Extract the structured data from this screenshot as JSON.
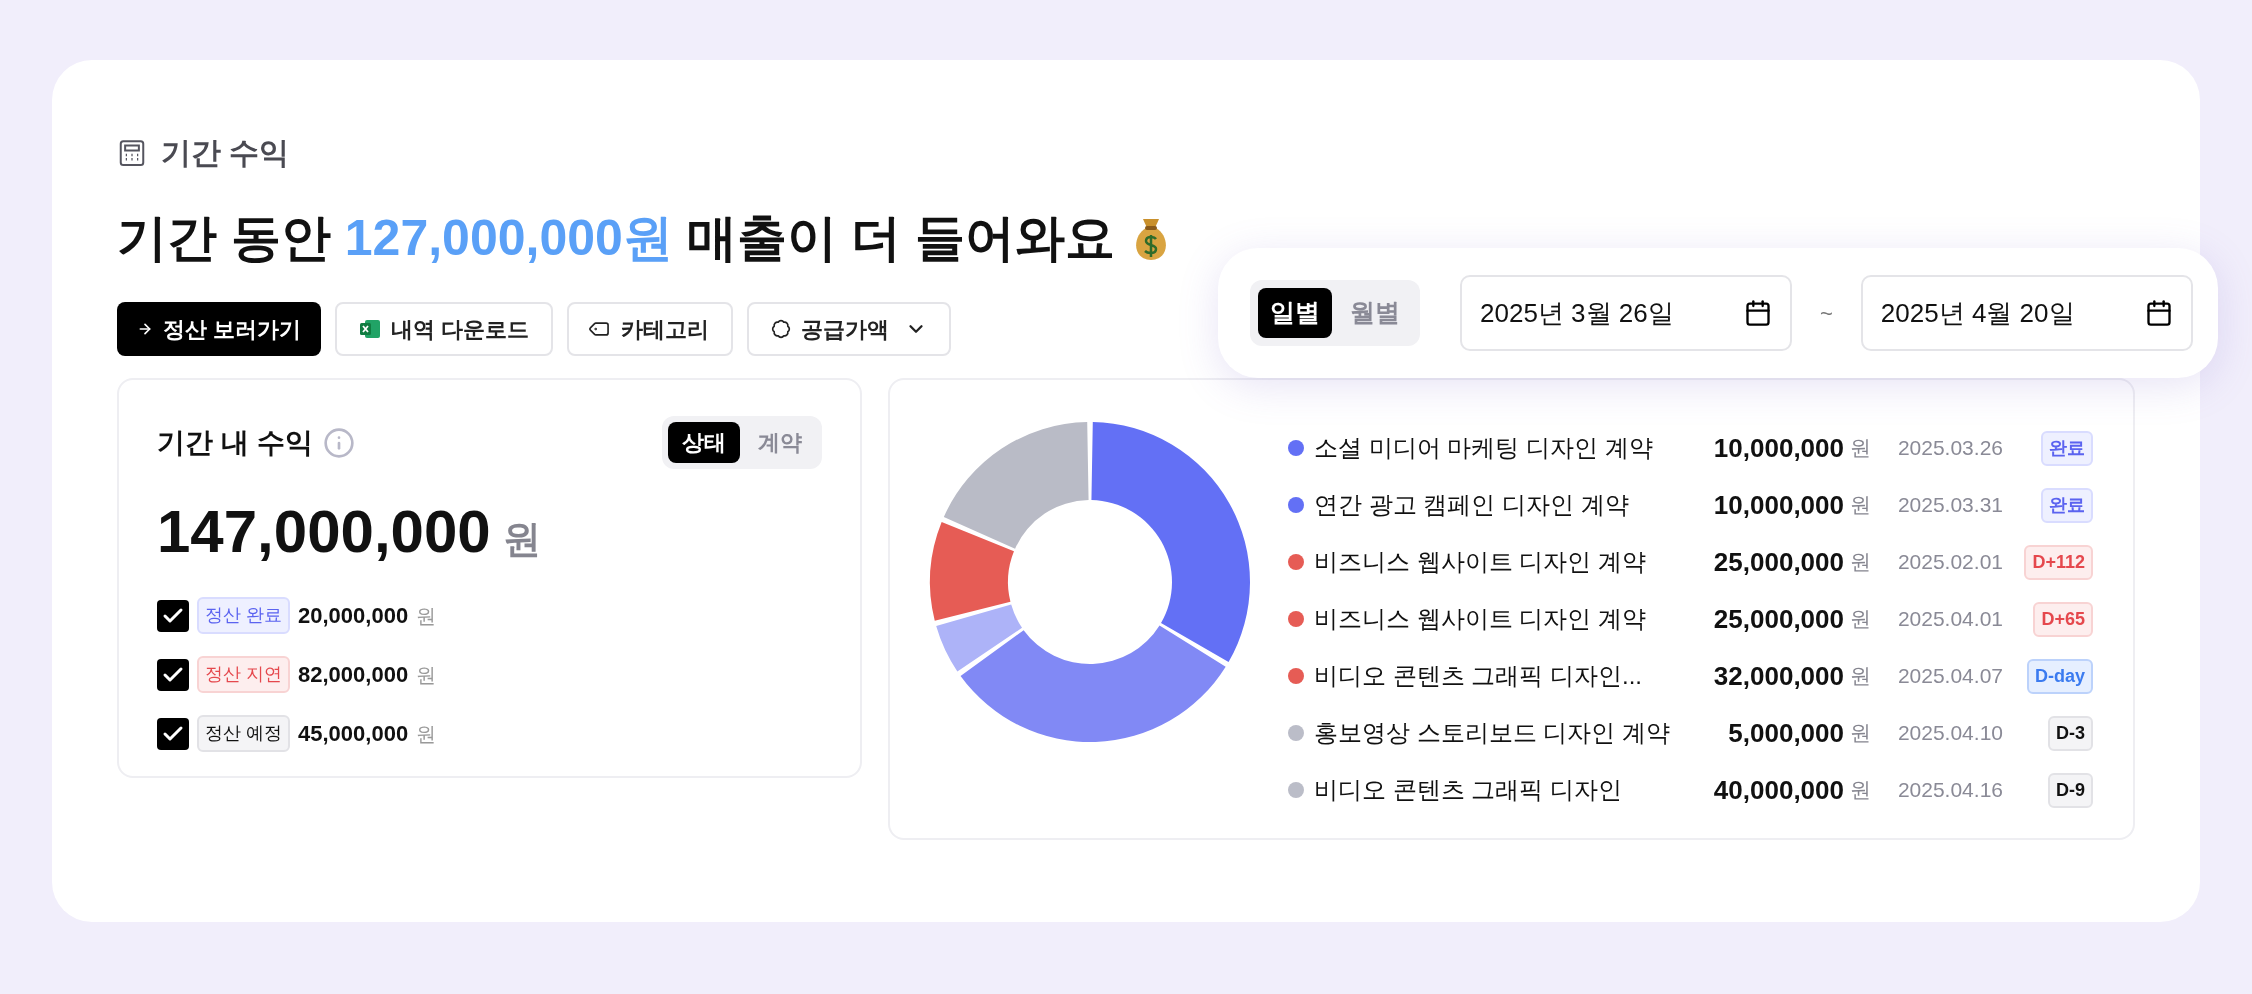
{
  "section_title": "기간 수익",
  "headline": {
    "prefix": "기간 동안 ",
    "amount": "127,000,000원",
    "suffix": " 매출이 더 들어와요"
  },
  "actions": [
    {
      "kind": "primary",
      "label": "정산 보러가기"
    },
    {
      "kind": "excel",
      "label": "내역 다운로드"
    },
    {
      "kind": "tag",
      "label": "카테고리"
    },
    {
      "kind": "dropdown",
      "label": "공급가액"
    }
  ],
  "period": {
    "tabs": [
      {
        "label": "일별",
        "selected": true
      },
      {
        "label": "월별",
        "selected": false
      }
    ],
    "start_date": "2025년 3월 26일",
    "separator": "~",
    "end_date": "2025년 4월 20일"
  },
  "revenue_card": {
    "title": "기간 내 수익",
    "tabs": [
      {
        "label": "상태",
        "selected": true
      },
      {
        "label": "계약",
        "selected": false
      }
    ],
    "total": "147,000,000",
    "currency": "원",
    "statuses": [
      {
        "kind": "done",
        "label": "정산 완료",
        "amount": "20,000,000",
        "currency": "원",
        "checked": true
      },
      {
        "kind": "late",
        "label": "정산 지연",
        "amount": "82,000,000",
        "currency": "원",
        "checked": true
      },
      {
        "kind": "planned",
        "label": "정산 예정",
        "amount": "45,000,000",
        "currency": "원",
        "checked": true
      }
    ]
  },
  "contracts": [
    {
      "name": "소셜 미디어 마케팅 디자인 계약",
      "amount": "10,000,000",
      "currency": "원",
      "date": "2025.03.26",
      "badge": "완료",
      "kind": "done",
      "color": "#6370f5"
    },
    {
      "name": "연간 광고 캠페인 디자인 계약",
      "amount": "10,000,000",
      "currency": "원",
      "date": "2025.03.31",
      "badge": "완료",
      "kind": "done",
      "color": "#6370f5"
    },
    {
      "name": "비즈니스 웹사이트 디자인 계약",
      "amount": "25,000,000",
      "currency": "원",
      "date": "2025.02.01",
      "badge": "D+112",
      "kind": "late",
      "color": "#e65c55"
    },
    {
      "name": "비즈니스 웹사이트 디자인 계약",
      "amount": "25,000,000",
      "currency": "원",
      "date": "2025.04.01",
      "badge": "D+65",
      "kind": "late",
      "color": "#e65c55"
    },
    {
      "name": "비디오 콘텐츠 그래픽 디자인...",
      "amount": "32,000,000",
      "currency": "원",
      "date": "2025.04.07",
      "badge": "D-day",
      "kind": "today",
      "color": "#e65c55"
    },
    {
      "name": "홍보영상 스토리보드 디자인 계약",
      "amount": "5,000,000",
      "currency": "원",
      "date": "2025.04.10",
      "badge": "D-3",
      "kind": "planned",
      "color": "#bbbdc8"
    },
    {
      "name": "비디오 콘텐츠 그래픽 디자인",
      "amount": "40,000,000",
      "currency": "원",
      "date": "2025.04.16",
      "badge": "D-9",
      "kind": "planned",
      "color": "#bbbdc8"
    }
  ]
}
